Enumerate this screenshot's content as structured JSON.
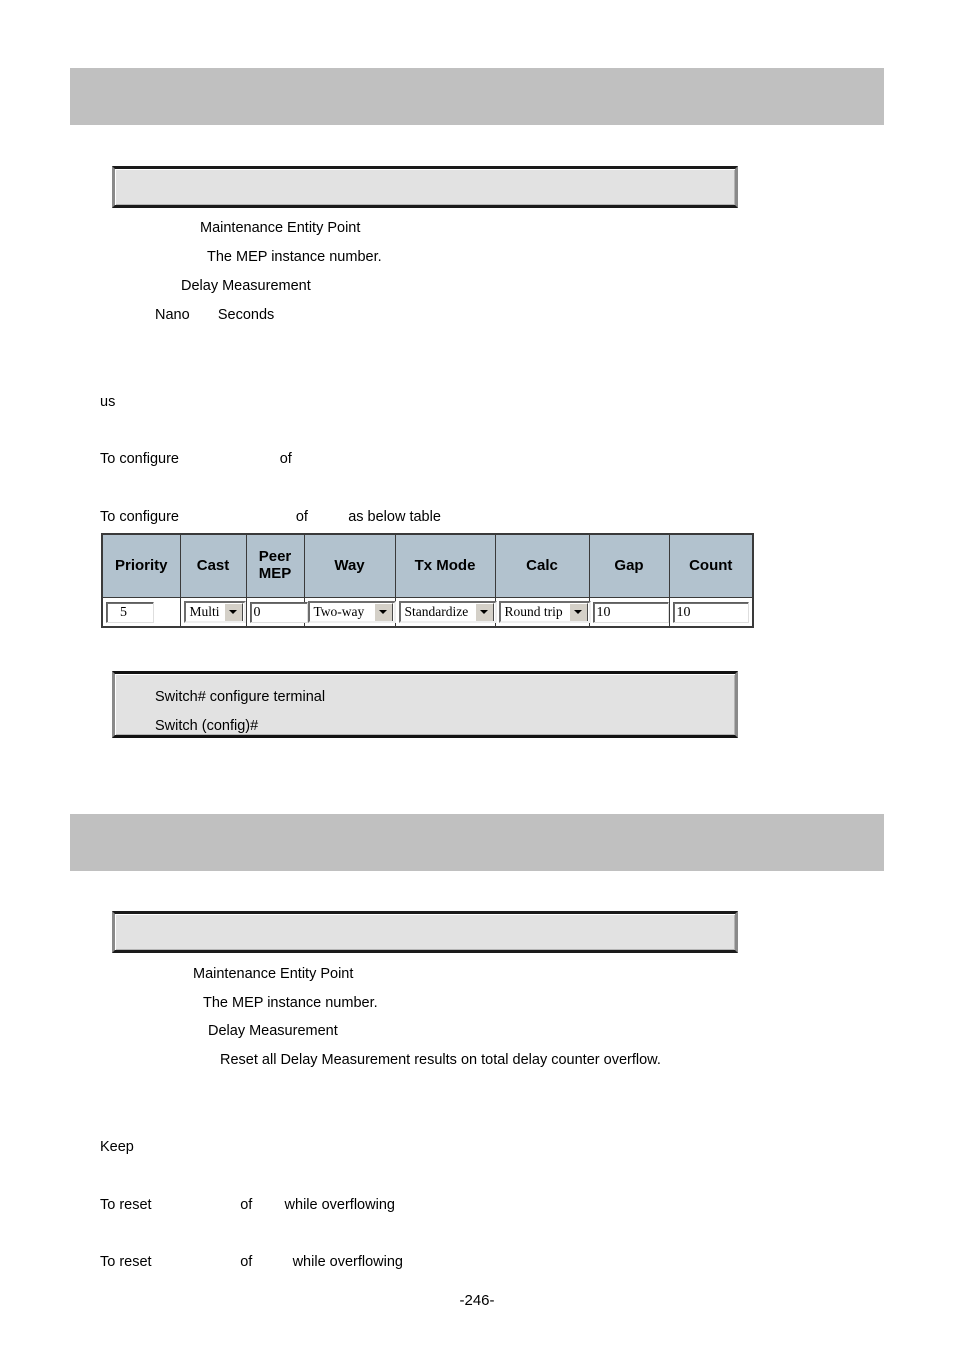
{
  "page": {
    "number": "-246-"
  },
  "sections": [
    {
      "band_label": "",
      "syntax_box": "",
      "descriptions": [
        "Maintenance Entity Point",
        "The MEP instance number.",
        "Delay Measurement",
        "Nano       Seconds"
      ],
      "notes": [
        "us"
      ],
      "instructions": [
        "To configure                         of",
        "To configure                             of          as below table"
      ]
    },
    {
      "band_label": "",
      "syntax_box": "",
      "descriptions": [
        "Maintenance Entity Point",
        "The MEP instance number.",
        "Delay Measurement",
        "Reset all Delay Measurement results on total delay counter overflow."
      ],
      "notes": [
        "Keep"
      ],
      "instructions": [
        "To reset                      of        while overflowing",
        "To reset                      of          while overflowing"
      ]
    }
  ],
  "param_table": {
    "columns": [
      "Priority",
      "Cast",
      "Peer\nMEP",
      "Way",
      "Tx Mode",
      "Calc",
      "Gap",
      "Count"
    ],
    "row": {
      "priority": "5",
      "cast": "Multi",
      "peer_mep": "0",
      "way": "Two-way",
      "tx_mode": "Standardize",
      "calc": "Round trip",
      "gap": "10",
      "count": "10"
    }
  },
  "cli_example": {
    "lines": [
      "Switch# configure terminal",
      "Switch (config)#"
    ]
  },
  "colors": {
    "band_gray": "#c0c0c0",
    "box_fill": "#e2e2e2",
    "table_header": "#b2c2ce",
    "border_dark": "#3a3a3a"
  }
}
